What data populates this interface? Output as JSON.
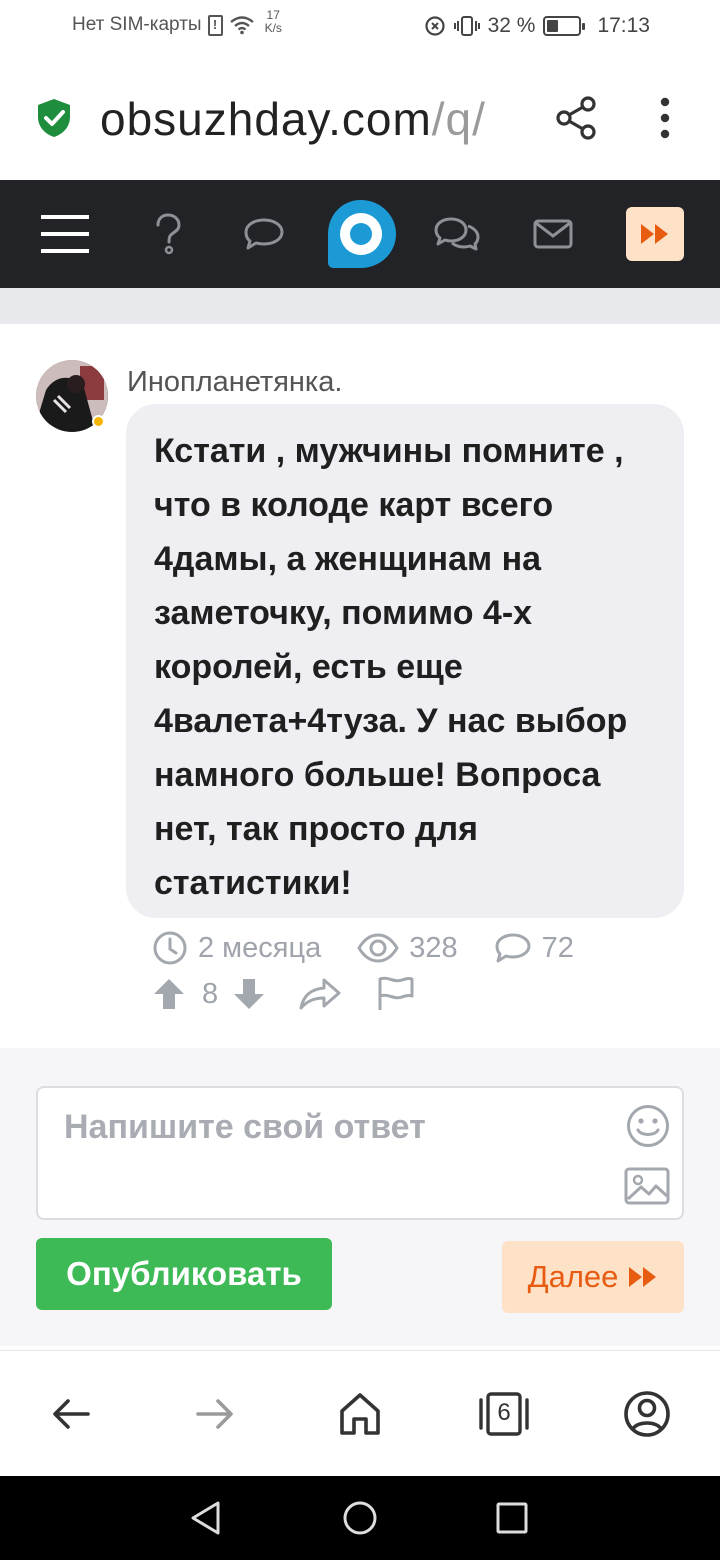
{
  "status_bar": {
    "carrier": "Нет SIM-карты",
    "net_speed_value": "17",
    "net_speed_unit": "K/s",
    "battery": "32 %",
    "time": "17:13"
  },
  "address_bar": {
    "domain": "obsuzhday.com",
    "path": "/q/"
  },
  "post": {
    "author": "Инопланетянка.",
    "text": "Кстати , мужчины помните , что в колоде карт всего 4дамы, а женщинам на заметочку, помимо 4-х королей, есть еще 4валета+4туза. У нас выбор намного больше! Вопроса нет, так просто для статистики!",
    "time_ago": "2 месяца",
    "views": "328",
    "comments": "72",
    "votes": "8"
  },
  "answer": {
    "placeholder": "Напишите свой ответ",
    "publish_label": "Опубликовать",
    "next_label": "Далее"
  },
  "browser_bar": {
    "tabs_count": "6"
  },
  "colors": {
    "brand_blue": "#1b9ad6",
    "publish_green": "#3dba55",
    "next_orange": "#e85c12",
    "next_bg": "#fde2c8",
    "nav_bg": "#222326",
    "shield_green": "#1e8e3e"
  }
}
